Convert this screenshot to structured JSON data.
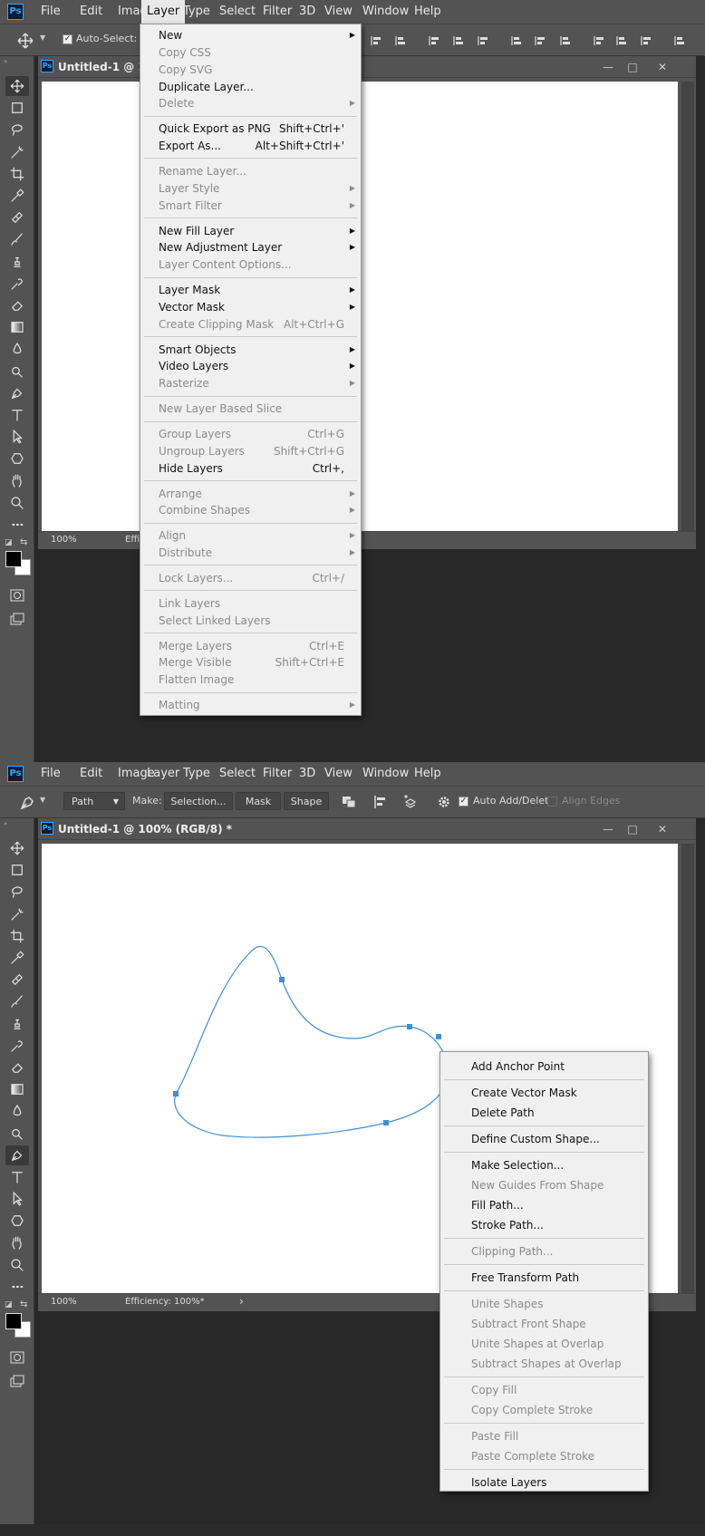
{
  "menubar": [
    "File",
    "Edit",
    "Image",
    "Layer",
    "Type",
    "Select",
    "Filter",
    "3D",
    "View",
    "Window",
    "Help"
  ],
  "app_logo": "Ps",
  "panel1": {
    "options": {
      "auto_select_label": "Auto-Select:"
    },
    "doc_title": "Untitled-1 @ 100%",
    "zoom": "100%",
    "status_text": "Effi",
    "layer_menu": [
      {
        "label": "New",
        "shortcut": "",
        "sub": true,
        "disabled": false
      },
      {
        "label": "Copy CSS",
        "shortcut": "",
        "sub": false,
        "disabled": true
      },
      {
        "label": "Copy SVG",
        "shortcut": "",
        "sub": false,
        "disabled": true
      },
      {
        "label": "Duplicate Layer...",
        "shortcut": "",
        "sub": false,
        "disabled": false
      },
      {
        "label": "Delete",
        "shortcut": "",
        "sub": true,
        "disabled": true
      },
      {
        "sep": true
      },
      {
        "label": "Quick Export as PNG",
        "shortcut": "Shift+Ctrl+'",
        "sub": false,
        "disabled": false
      },
      {
        "label": "Export As...",
        "shortcut": "Alt+Shift+Ctrl+'",
        "sub": false,
        "disabled": false
      },
      {
        "sep": true
      },
      {
        "label": "Rename Layer...",
        "shortcut": "",
        "sub": false,
        "disabled": true
      },
      {
        "label": "Layer Style",
        "shortcut": "",
        "sub": true,
        "disabled": true
      },
      {
        "label": "Smart Filter",
        "shortcut": "",
        "sub": true,
        "disabled": true
      },
      {
        "sep": true
      },
      {
        "label": "New Fill Layer",
        "shortcut": "",
        "sub": true,
        "disabled": false
      },
      {
        "label": "New Adjustment Layer",
        "shortcut": "",
        "sub": true,
        "disabled": false
      },
      {
        "label": "Layer Content Options...",
        "shortcut": "",
        "sub": false,
        "disabled": true
      },
      {
        "sep": true
      },
      {
        "label": "Layer Mask",
        "shortcut": "",
        "sub": true,
        "disabled": false
      },
      {
        "label": "Vector Mask",
        "shortcut": "",
        "sub": true,
        "disabled": false
      },
      {
        "label": "Create Clipping Mask",
        "shortcut": "Alt+Ctrl+G",
        "sub": false,
        "disabled": true
      },
      {
        "sep": true
      },
      {
        "label": "Smart Objects",
        "shortcut": "",
        "sub": true,
        "disabled": false
      },
      {
        "label": "Video Layers",
        "shortcut": "",
        "sub": true,
        "disabled": false
      },
      {
        "label": "Rasterize",
        "shortcut": "",
        "sub": true,
        "disabled": true
      },
      {
        "sep": true
      },
      {
        "label": "New Layer Based Slice",
        "shortcut": "",
        "sub": false,
        "disabled": true
      },
      {
        "sep": true
      },
      {
        "label": "Group Layers",
        "shortcut": "Ctrl+G",
        "sub": false,
        "disabled": true
      },
      {
        "label": "Ungroup Layers",
        "shortcut": "Shift+Ctrl+G",
        "sub": false,
        "disabled": true
      },
      {
        "label": "Hide Layers",
        "shortcut": "Ctrl+,",
        "sub": false,
        "disabled": false
      },
      {
        "sep": true
      },
      {
        "label": "Arrange",
        "shortcut": "",
        "sub": true,
        "disabled": true
      },
      {
        "label": "Combine Shapes",
        "shortcut": "",
        "sub": true,
        "disabled": true
      },
      {
        "sep": true
      },
      {
        "label": "Align",
        "shortcut": "",
        "sub": true,
        "disabled": true
      },
      {
        "label": "Distribute",
        "shortcut": "",
        "sub": true,
        "disabled": true
      },
      {
        "sep": true
      },
      {
        "label": "Lock Layers...",
        "shortcut": "Ctrl+/",
        "sub": false,
        "disabled": true
      },
      {
        "sep": true
      },
      {
        "label": "Link Layers",
        "shortcut": "",
        "sub": false,
        "disabled": true
      },
      {
        "label": "Select Linked Layers",
        "shortcut": "",
        "sub": false,
        "disabled": true
      },
      {
        "sep": true
      },
      {
        "label": "Merge Layers",
        "shortcut": "Ctrl+E",
        "sub": false,
        "disabled": true
      },
      {
        "label": "Merge Visible",
        "shortcut": "Shift+Ctrl+E",
        "sub": false,
        "disabled": true
      },
      {
        "label": "Flatten Image",
        "shortcut": "",
        "sub": false,
        "disabled": true
      },
      {
        "sep": true
      },
      {
        "label": "Matting",
        "shortcut": "",
        "sub": true,
        "disabled": true
      }
    ]
  },
  "panel2": {
    "options": {
      "mode_value": "Path",
      "make_label": "Make:",
      "selection_button": "Selection...",
      "mask_button": "Mask",
      "shape_button": "Shape",
      "auto_add_delete_label": "Auto Add/Delete",
      "align_edges_label": "Align Edges"
    },
    "doc_title": "Untitled-1 @ 100% (RGB/8) *",
    "zoom": "100%",
    "status_text": "Efficiency: 100%*",
    "path_color": "#3d8fd6",
    "context_menu": [
      {
        "label": "Add Anchor Point",
        "disabled": false
      },
      {
        "sep": true
      },
      {
        "label": "Create Vector Mask",
        "disabled": false
      },
      {
        "label": "Delete Path",
        "disabled": false
      },
      {
        "sep": true
      },
      {
        "label": "Define Custom Shape...",
        "disabled": false
      },
      {
        "sep": true
      },
      {
        "label": "Make Selection...",
        "disabled": false
      },
      {
        "label": "New Guides From Shape",
        "disabled": true
      },
      {
        "label": "Fill Path...",
        "disabled": false
      },
      {
        "label": "Stroke Path...",
        "disabled": false
      },
      {
        "sep": true
      },
      {
        "label": "Clipping Path...",
        "disabled": true
      },
      {
        "sep": true
      },
      {
        "label": "Free Transform Path",
        "disabled": false
      },
      {
        "sep": true
      },
      {
        "label": "Unite Shapes",
        "disabled": true
      },
      {
        "label": "Subtract Front Shape",
        "disabled": true
      },
      {
        "label": "Unite Shapes at Overlap",
        "disabled": true
      },
      {
        "label": "Subtract Shapes at Overlap",
        "disabled": true
      },
      {
        "sep": true
      },
      {
        "label": "Copy Fill",
        "disabled": true
      },
      {
        "label": "Copy Complete Stroke",
        "disabled": true
      },
      {
        "sep": true
      },
      {
        "label": "Paste Fill",
        "disabled": true
      },
      {
        "label": "Paste Complete Stroke",
        "disabled": true
      },
      {
        "sep": true
      },
      {
        "label": "Isolate Layers",
        "disabled": false
      }
    ]
  }
}
